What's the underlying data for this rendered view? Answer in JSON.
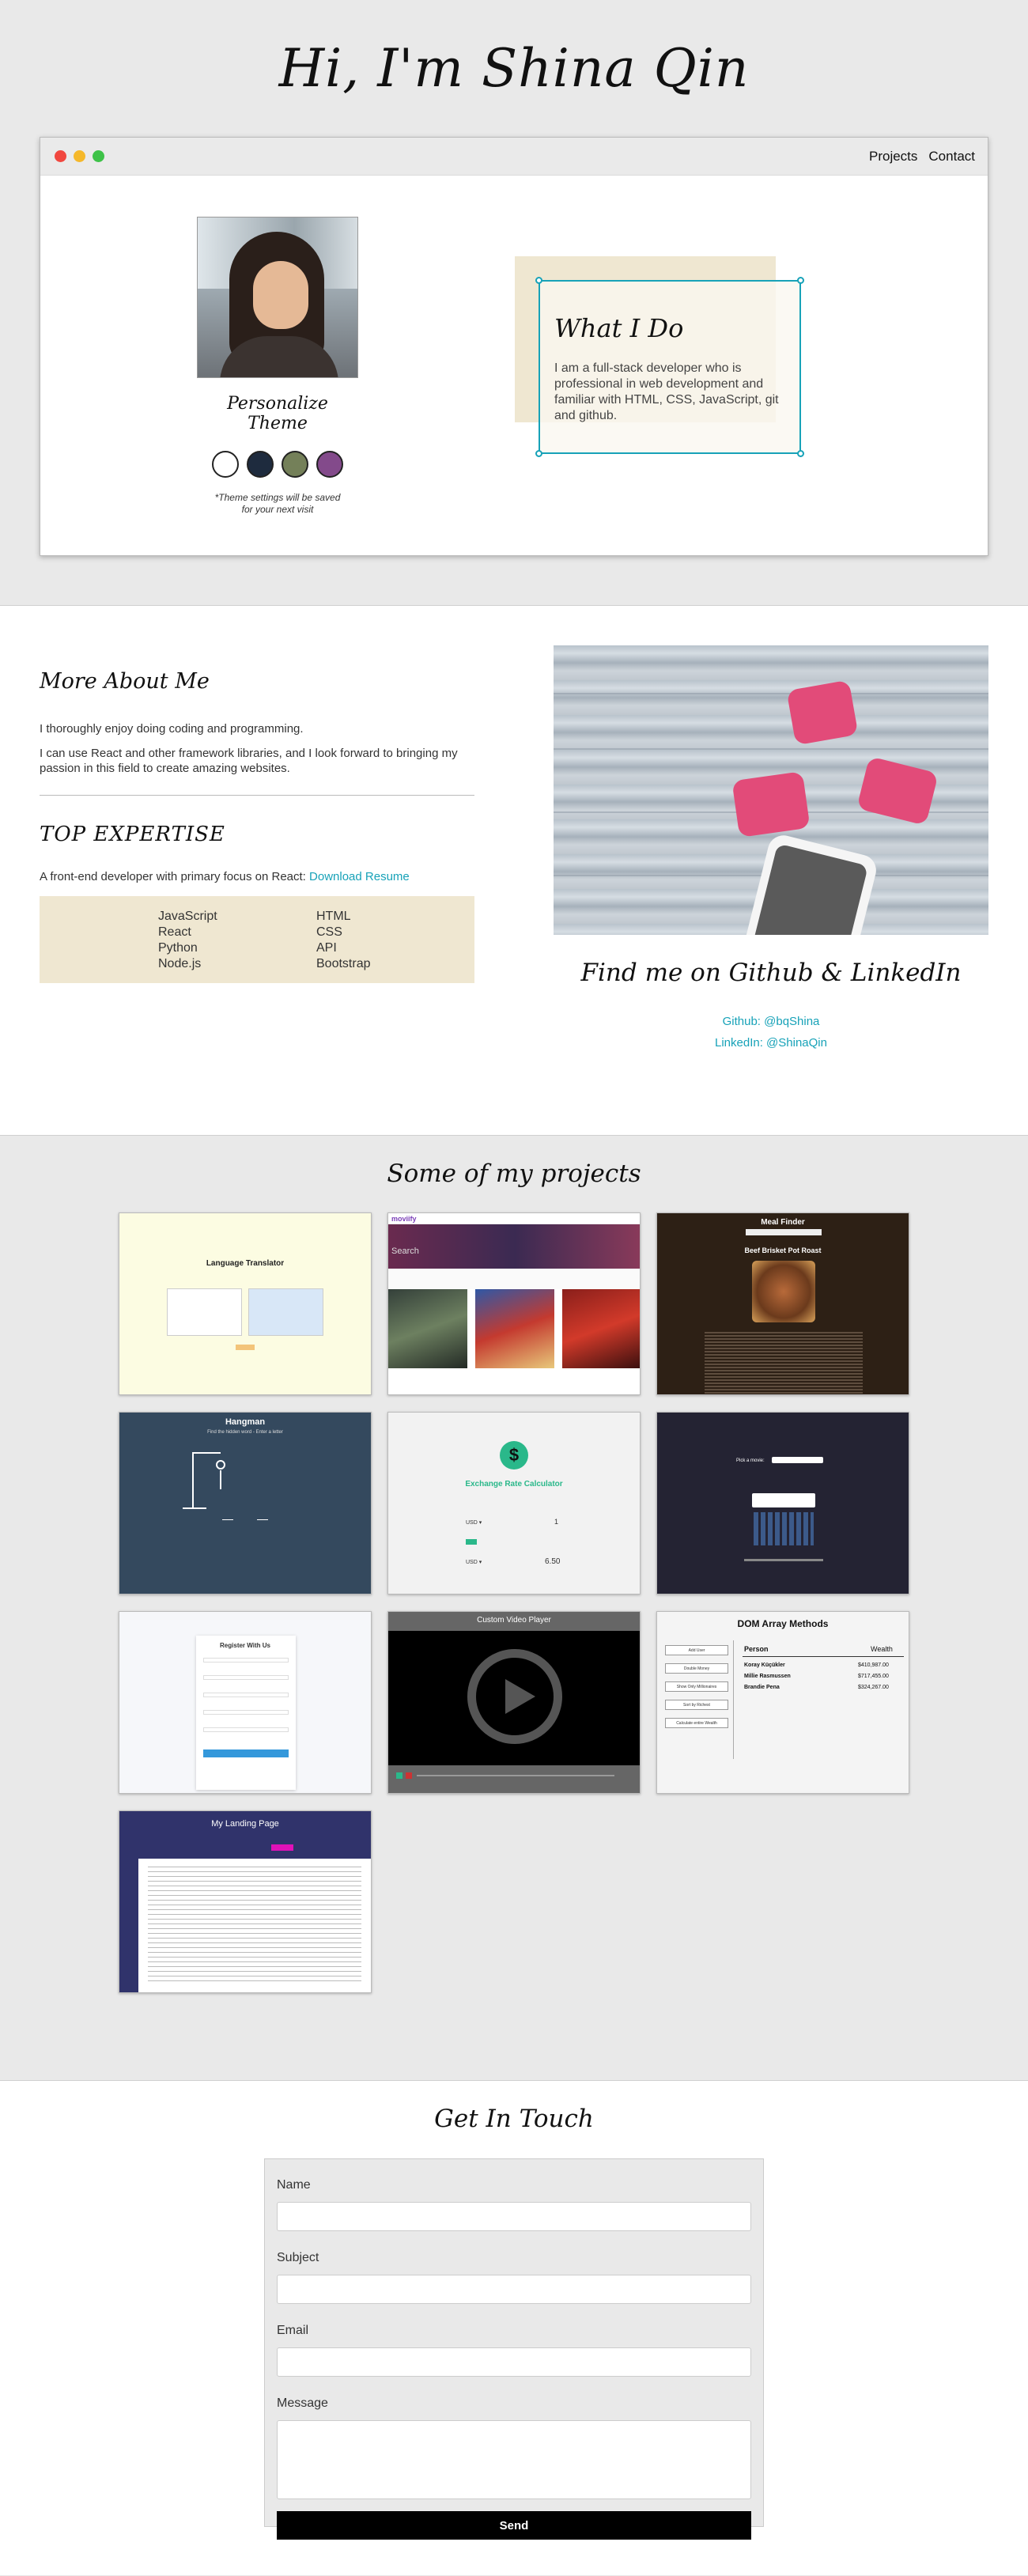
{
  "hero": {
    "title": "Hi, I'm Shina Qin",
    "nav": [
      "Projects",
      "Contact"
    ]
  },
  "profile": {
    "theme_title": "Personalize Theme",
    "theme_note": "*Theme settings will be saved for your next visit",
    "swatch_colors": [
      "#ffffff",
      "#1e2b3e",
      "#748059",
      "#834a8b"
    ]
  },
  "whatido": {
    "title": "What I Do",
    "text": "I am a full-stack developer who is professional in web development and familiar with HTML, CSS, JavaScript, git and github."
  },
  "about": {
    "title": "More About Me",
    "p1": "I thoroughly enjoy doing coding and programming.",
    "p2": "I can use React and other framework libraries, and I look forward to bringing my passion in this field to create amazing websites.",
    "expertise_title": "TOP EXPERTISE",
    "focus_text": "A front-end developer with primary focus on React: ",
    "resume_link": "Download Resume",
    "skills_col1": [
      "JavaScript",
      "React",
      "Python",
      "Node.js"
    ],
    "skills_col2": [
      "HTML",
      "CSS",
      "API",
      "Bootstrap"
    ]
  },
  "social": {
    "title": "Find me on Github & LinkedIn",
    "github": "Github: @bqShina",
    "linkedin": "LinkedIn: @ShinaQin"
  },
  "projects": {
    "title": "Some of my projects",
    "cards": [
      {
        "title": "Language Translator"
      },
      {
        "title": "moviify",
        "search": "Search"
      },
      {
        "title": "Meal Finder",
        "subtitle": "Beef Brisket Pot Roast"
      },
      {
        "title": "Hangman",
        "subtitle": "Find the hidden word - Enter a letter"
      },
      {
        "title": "Exchange Rate Calculator",
        "from": "USD ▾",
        "from_val": "1",
        "to": "USD ▾",
        "to_val": "6.50"
      },
      {
        "title": "Pick a movie:"
      },
      {
        "title": "Register With Us"
      },
      {
        "title": "Custom Video Player"
      },
      {
        "title": "DOM Array Methods",
        "col1": "Person",
        "col2": "Wealth",
        "rows": [
          [
            "Koray Küçükler",
            "$410,987.00"
          ],
          [
            "Millie Rasmussen",
            "$717,455.00"
          ],
          [
            "Brandie Pena",
            "$324,267.00"
          ]
        ],
        "buttons": [
          "Add User",
          "Double Money",
          "Show Only Millionaires",
          "Sort by Richest",
          "Calculate entire Wealth"
        ]
      },
      {
        "title": "My Landing Page"
      }
    ]
  },
  "contact": {
    "title": "Get In Touch",
    "labels": {
      "name": "Name",
      "subject": "Subject",
      "email": "Email",
      "message": "Message"
    },
    "send": "Send"
  }
}
